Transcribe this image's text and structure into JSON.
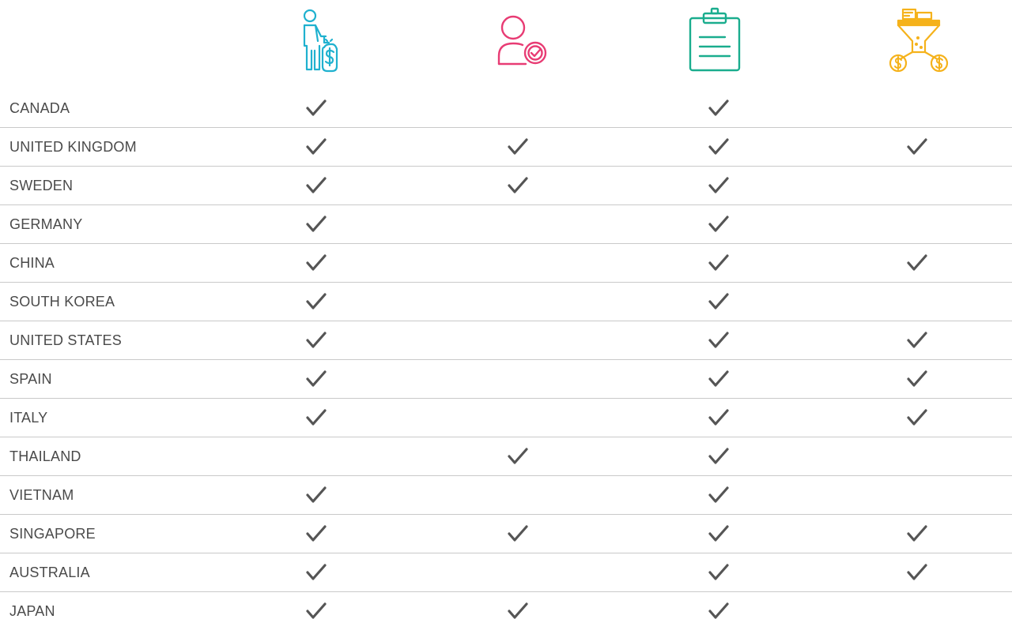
{
  "columns": [
    {
      "icon": "person-with-money-bag-icon",
      "color": "#1fb1cf"
    },
    {
      "icon": "user-verified-icon",
      "color": "#e83c74"
    },
    {
      "icon": "clipboard-document-icon",
      "color": "#1aad8e"
    },
    {
      "icon": "funnel-to-coins-icon",
      "color": "#f5b21b"
    }
  ],
  "check_color": "#555555",
  "rows": [
    {
      "country": "CANADA",
      "checks": [
        true,
        false,
        true,
        false
      ]
    },
    {
      "country": "UNITED KINGDOM",
      "checks": [
        true,
        true,
        true,
        true
      ]
    },
    {
      "country": "SWEDEN",
      "checks": [
        true,
        true,
        true,
        false
      ]
    },
    {
      "country": "GERMANY",
      "checks": [
        true,
        false,
        true,
        false
      ]
    },
    {
      "country": "CHINA",
      "checks": [
        true,
        false,
        true,
        true
      ]
    },
    {
      "country": "SOUTH KOREA",
      "checks": [
        true,
        false,
        true,
        false
      ]
    },
    {
      "country": "UNITED STATES",
      "checks": [
        true,
        false,
        true,
        true
      ]
    },
    {
      "country": "SPAIN",
      "checks": [
        true,
        false,
        true,
        true
      ]
    },
    {
      "country": "ITALY",
      "checks": [
        true,
        false,
        true,
        true
      ]
    },
    {
      "country": "THAILAND",
      "checks": [
        false,
        true,
        true,
        false
      ]
    },
    {
      "country": "VIETNAM",
      "checks": [
        true,
        false,
        true,
        false
      ]
    },
    {
      "country": "SINGAPORE",
      "checks": [
        true,
        true,
        true,
        true
      ]
    },
    {
      "country": "AUSTRALIA",
      "checks": [
        true,
        false,
        true,
        true
      ]
    },
    {
      "country": "JAPAN",
      "checks": [
        true,
        true,
        true,
        false
      ]
    }
  ]
}
